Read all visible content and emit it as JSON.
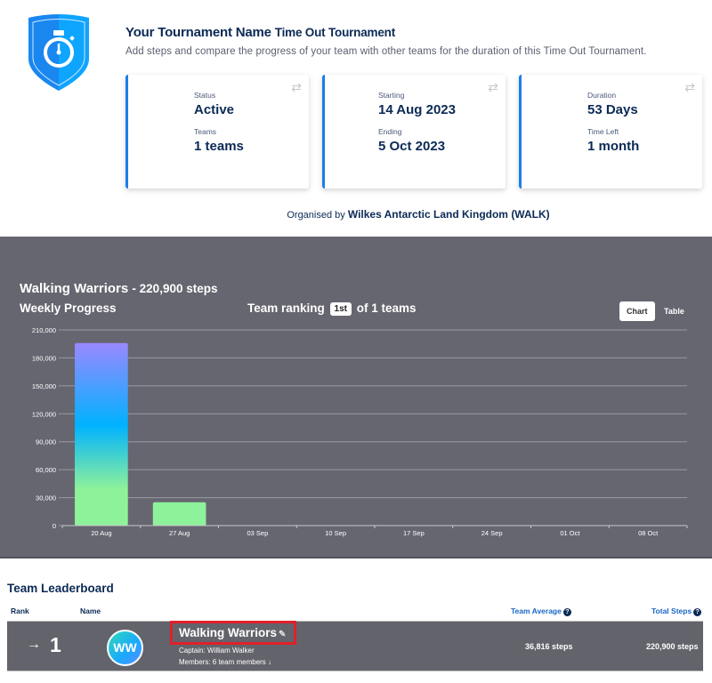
{
  "header": {
    "title": "Your Tournament Name",
    "tournament_name": "Time Out Tournament",
    "description": "Add steps and compare the progress of your team with other teams for the duration of this Time Out Tournament.",
    "logo_icon": "stopwatch-shield-icon",
    "organised_label": "Organised by",
    "organiser": "Wilkes Antarctic Land Kingdom (WALK)"
  },
  "cards": [
    {
      "label1": "Status",
      "value1": "Active",
      "label2": "Teams",
      "value2": "1 teams"
    },
    {
      "label1": "Starting",
      "value1": "14 Aug 2023",
      "label2": "Ending",
      "value2": "5 Oct 2023"
    },
    {
      "label1": "Duration",
      "value1": "53 Days",
      "label2": "Time Left",
      "value2": "1 month"
    }
  ],
  "progress": {
    "team_name": "Walking Warriors",
    "team_steps": "- 220,900 steps",
    "weekly_label": "Weekly Progress",
    "ranking_prefix": "Team ranking",
    "ranking_badge": "1st",
    "ranking_suffix": "of 1 teams",
    "toggle_chart": "Chart",
    "toggle_table": "Table"
  },
  "chart_data": {
    "type": "bar",
    "title": "Weekly Progress",
    "xlabel": "",
    "ylabel": "",
    "categories": [
      "20 Aug",
      "27 Aug",
      "03 Sep",
      "10 Sep",
      "17 Sep",
      "24 Sep",
      "01 Oct",
      "08 Oct"
    ],
    "values": [
      195900,
      25000,
      0,
      0,
      0,
      0,
      0,
      0
    ],
    "ylim": [
      0,
      210000
    ],
    "yticks": [
      0,
      30000,
      60000,
      90000,
      120000,
      150000,
      180000,
      210000
    ],
    "ytick_labels": [
      "0",
      "30,000",
      "60,000",
      "90,000",
      "120,000",
      "150,000",
      "180,000",
      "210,000"
    ],
    "grid": true,
    "colors": {
      "gradient_top": "#9a88ff",
      "gradient_mid": "#00b2ff",
      "gradient_bottom": "#8ef29a"
    }
  },
  "leaderboard": {
    "title": "Team Leaderboard",
    "columns": {
      "rank": "Rank",
      "name": "Name",
      "average": "Team Average",
      "total": "Total Steps"
    },
    "rows": [
      {
        "trend_icon": "→",
        "rank": "1",
        "initials": "WW",
        "name": "Walking Warriors",
        "captain": "Captain: William Walker",
        "members": "Members: 6 team members ↓",
        "average": "36,816 steps",
        "total": "220,900 steps"
      }
    ]
  }
}
